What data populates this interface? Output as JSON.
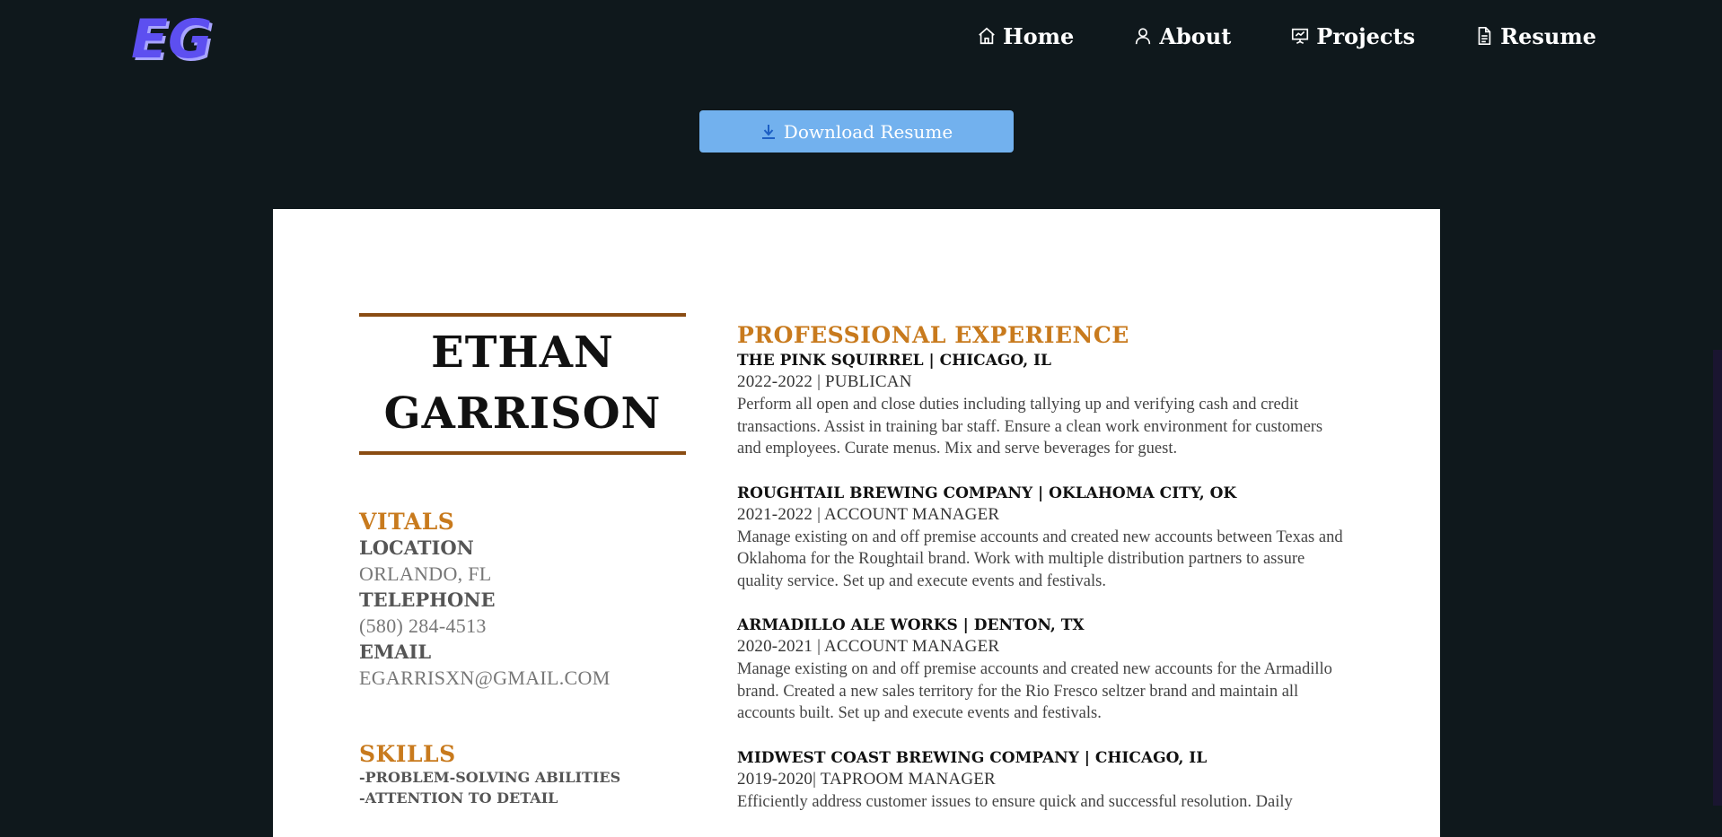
{
  "nav": {
    "logo_text": "EG",
    "links": [
      {
        "label": "Home",
        "icon": "home-icon"
      },
      {
        "label": "About",
        "icon": "user-icon"
      },
      {
        "label": "Projects",
        "icon": "presentation-icon"
      },
      {
        "label": "Resume",
        "icon": "document-icon"
      }
    ]
  },
  "download": {
    "label": "Download Resume",
    "icon": "download-icon"
  },
  "resume": {
    "first_name": "ETHAN",
    "last_name": "GARRISON",
    "vitals": {
      "heading": "VITALS",
      "location_label": "LOCATION",
      "location": "ORLANDO, FL",
      "telephone_label": "TELEPHONE",
      "telephone": "(580) 284-4513",
      "email_label": "EMAIL",
      "email": "EGARRISXN@GMAIL.COM"
    },
    "skills": {
      "heading": "SKILLS",
      "items": [
        "-PROBLEM-SOLVING ABILITIES",
        "-ATTENTION TO DETAIL"
      ]
    },
    "experience": {
      "heading": "PROFESSIONAL EXPERIENCE",
      "jobs": [
        {
          "company": "THE PINK SQUIRREL | CHICAGO, IL",
          "role": "2022-2022 | PUBLICAN",
          "desc": "Perform all open and close duties including tallying up and verifying cash and credit transactions. Assist in training bar staff. Ensure a clean work environment for customers and employees. Curate menus. Mix and serve beverages for guest."
        },
        {
          "company": "ROUGHTAIL BREWING COMPANY | OKLAHOMA CITY, OK",
          "role": "2021-2022 | ACCOUNT MANAGER",
          "desc": "Manage existing on and off premise accounts and created new accounts between Texas and Oklahoma for the Roughtail brand. Work with multiple distribution partners to assure quality service. Set up and execute events and festivals."
        },
        {
          "company": "ARMADILLO ALE WORKS | DENTON, TX",
          "role": "2020-2021 | ACCOUNT MANAGER",
          "desc": "Manage existing on and off premise accounts and created new accounts for the Armadillo brand. Created a new sales territory for the Rio Fresco seltzer brand and maintain all accounts built. Set up and execute events and festivals."
        },
        {
          "company": "MIDWEST COAST BREWING COMPANY | CHICAGO, IL",
          "role": "2019-2020| TAPROOM MANAGER",
          "desc": "Efficiently address customer issues to ensure quick and successful resolution. Daily"
        }
      ]
    }
  }
}
